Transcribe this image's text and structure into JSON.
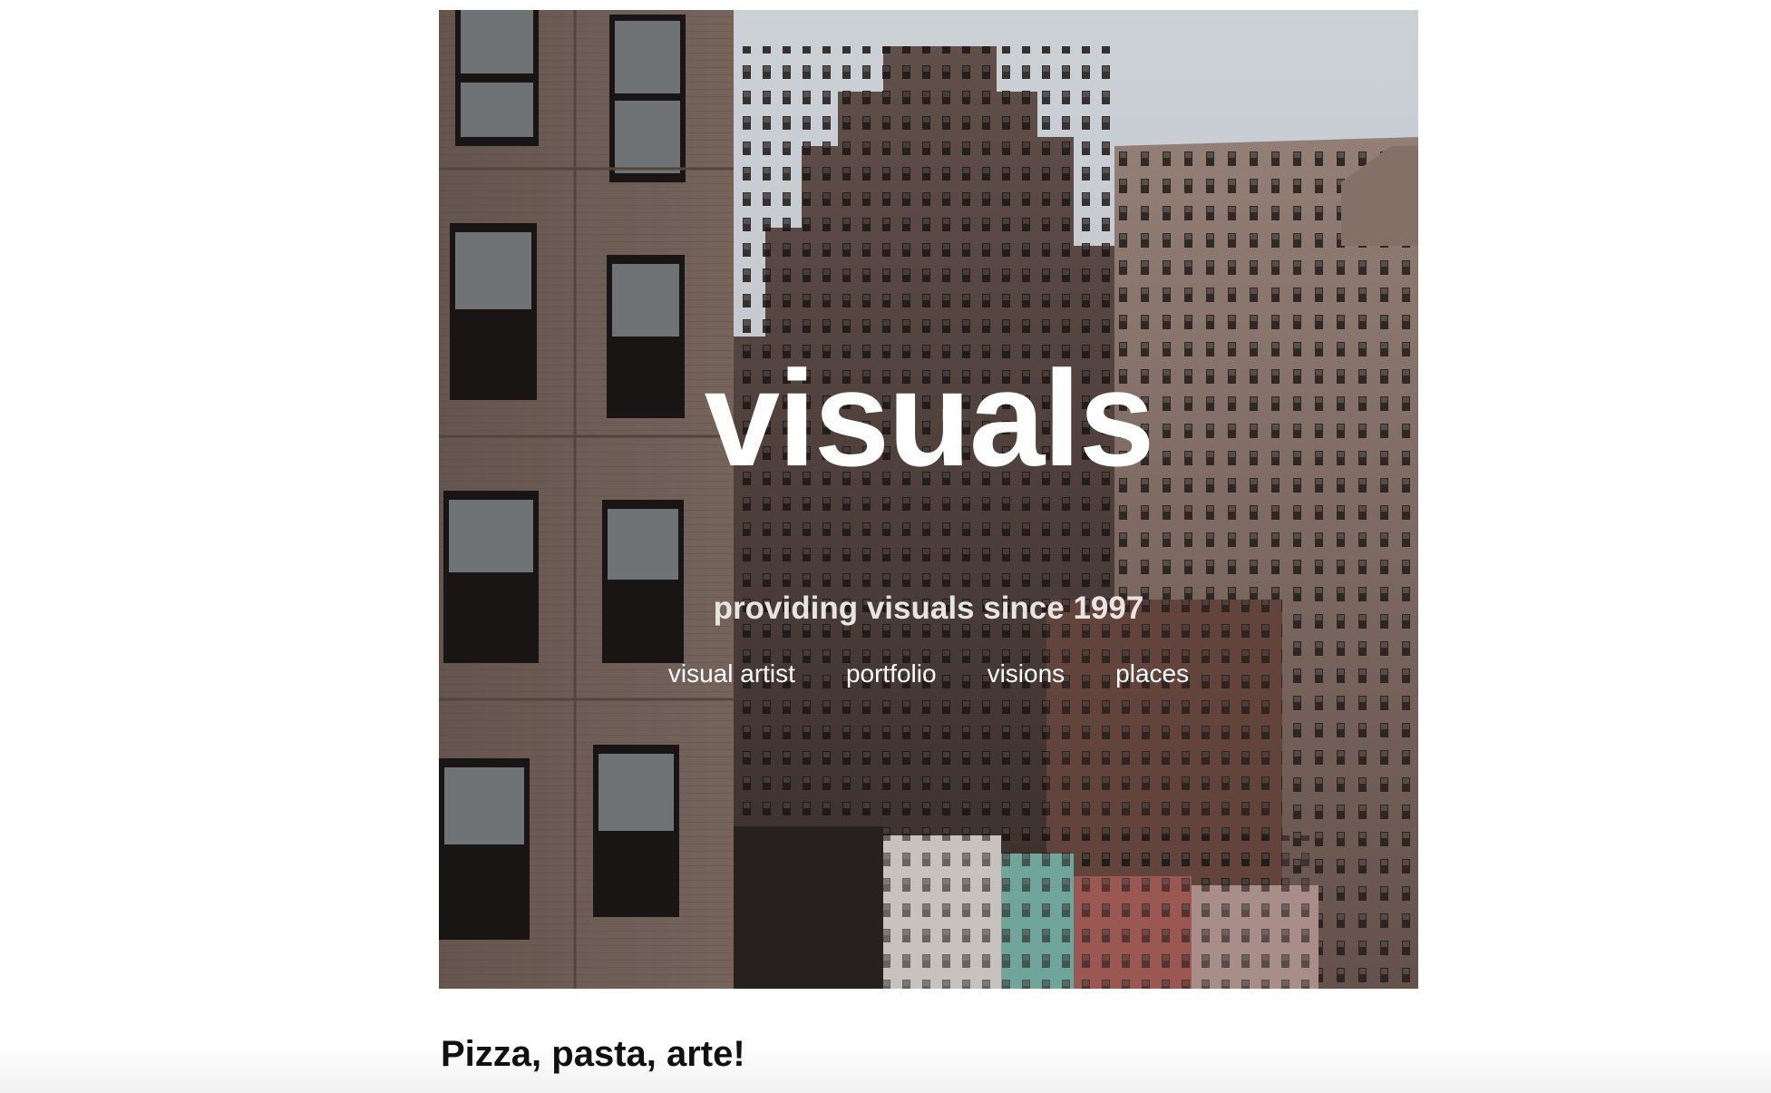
{
  "hero": {
    "title": "visuals",
    "tagline": "providing visuals since 1997",
    "image_icon": "city-buildings-photo"
  },
  "nav": {
    "items": [
      {
        "label": "visual artist"
      },
      {
        "label": "portfolio"
      },
      {
        "label": "visions"
      },
      {
        "label": "places"
      }
    ]
  },
  "content": {
    "heading": "Pizza, pasta, arte!"
  },
  "colors": {
    "background": "#ffffff",
    "hero_text": "#ffffff",
    "heading_text": "#111111"
  }
}
